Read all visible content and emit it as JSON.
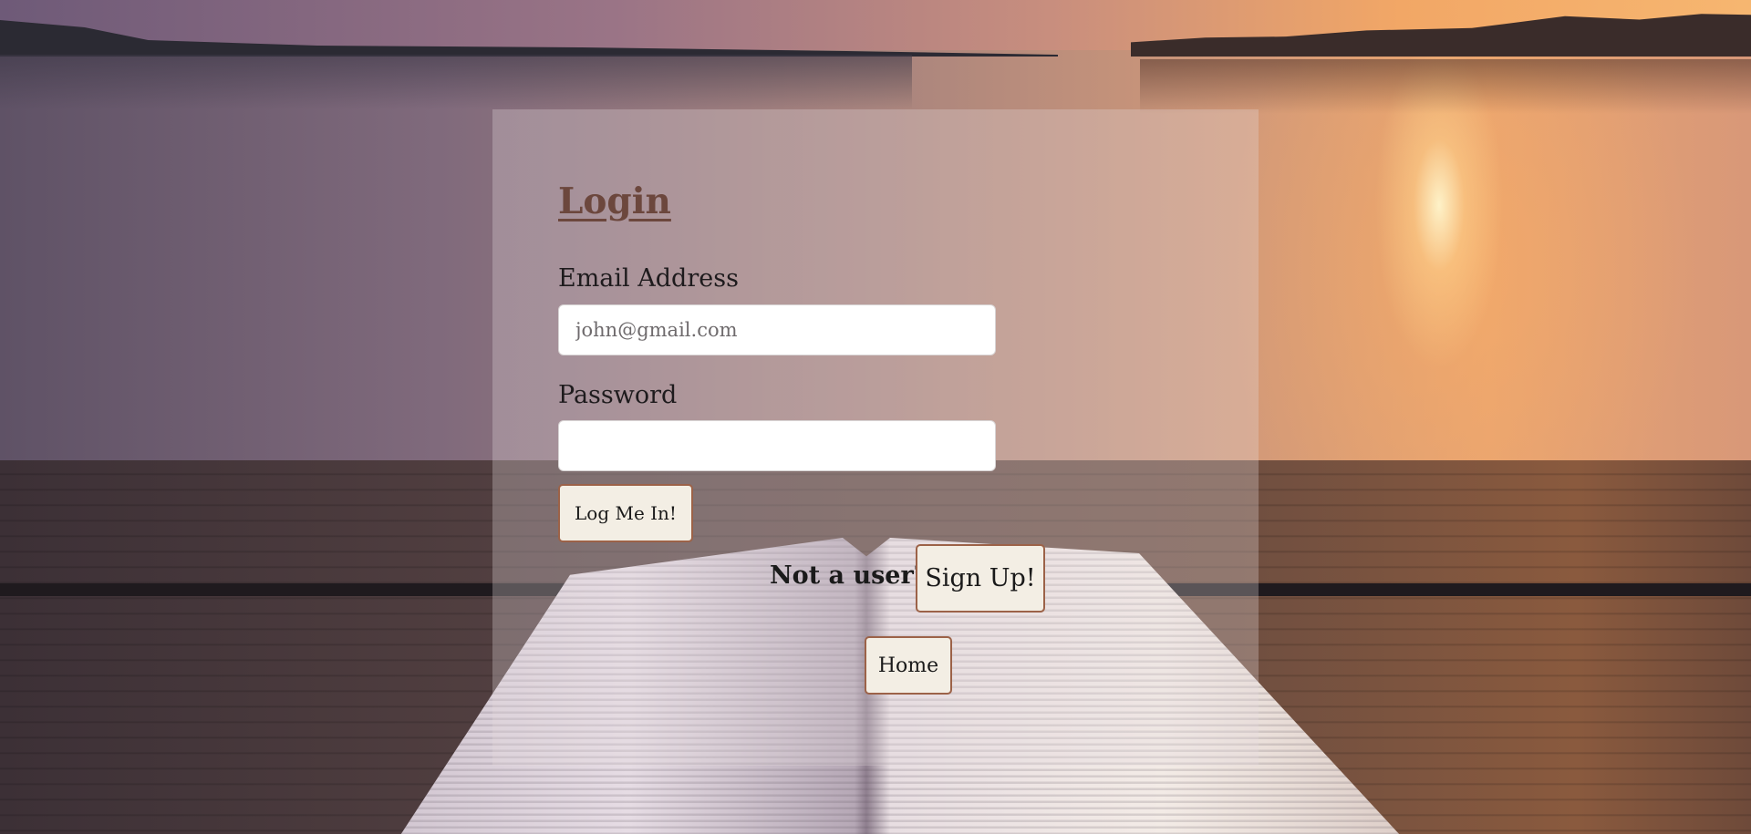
{
  "login": {
    "title": "Login",
    "email_label": "Email Address",
    "email_placeholder": "john@gmail.com",
    "email_value": "",
    "password_label": "Password",
    "password_value": "",
    "login_button": "Log Me In!",
    "not_user_text": "Not a user?",
    "signup_button": "Sign Up!",
    "home_button": "Home"
  },
  "colors": {
    "title": "#6c473d",
    "button_bg": "#f3eee4",
    "button_border": "#9c6248",
    "card_overlay": "rgba(230,220,222,0.30)"
  }
}
